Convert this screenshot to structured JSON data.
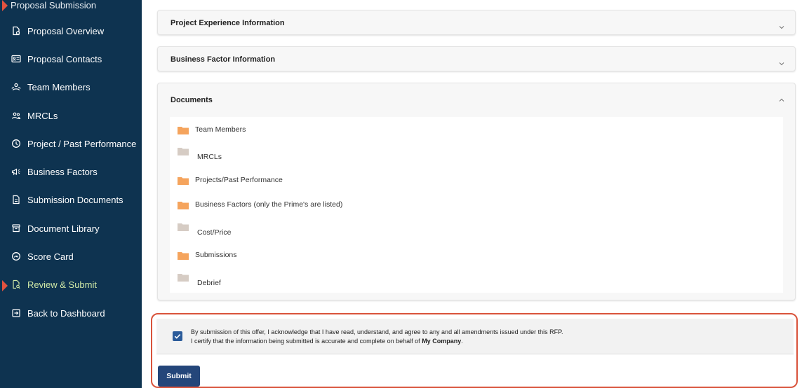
{
  "sidebar": {
    "header": "Proposal Submission",
    "items": [
      {
        "label": "Proposal Overview",
        "icon": "document-icon"
      },
      {
        "label": "Proposal Contacts",
        "icon": "contact-card-icon"
      },
      {
        "label": "Team Members",
        "icon": "team-icon"
      },
      {
        "label": "MRCLs",
        "icon": "users-icon"
      },
      {
        "label": "Project / Past Performance",
        "icon": "history-icon"
      },
      {
        "label": "Business Factors",
        "icon": "megaphone-icon"
      },
      {
        "label": "Submission Documents",
        "icon": "file-icon"
      },
      {
        "label": "Document Library",
        "icon": "archive-icon"
      },
      {
        "label": "Score Card",
        "icon": "gauge-icon"
      },
      {
        "label": "Review & Submit",
        "icon": "review-icon",
        "active": true
      },
      {
        "label": "Back to Dashboard",
        "icon": "exit-icon"
      }
    ]
  },
  "panels": {
    "project_experience": "Project Experience Information",
    "business_factor": "Business Factor Information",
    "documents": "Documents"
  },
  "documents": [
    {
      "label": "Team Members",
      "folder_color": "#f5a45d"
    },
    {
      "label": "MRCLs",
      "folder_color": "#d6ccc4"
    },
    {
      "label": "Projects/Past Performance",
      "folder_color": "#f5a45d"
    },
    {
      "label": "Business Factors (only the Prime's are listed)",
      "folder_color": "#f5a45d"
    },
    {
      "label": "Cost/Price",
      "folder_color": "#d6ccc4"
    },
    {
      "label": "Submissions",
      "folder_color": "#f5a45d"
    },
    {
      "label": "Debrief",
      "folder_color": "#d6ccc4"
    }
  ],
  "acknowledgement": {
    "line1": "By submission of this offer, I acknowledge that I have read, understand, and agree to any and all amendments issued under this RFP.",
    "line2_prefix": "I certify that the information being submitted is accurate and complete on behalf of ",
    "company": "My Company",
    "line2_suffix": ".",
    "checked": true
  },
  "submit_label": "Submit",
  "colors": {
    "sidebar_bg": "#0e3350",
    "active_marker": "#e2523f",
    "active_text": "#cfe8a6",
    "highlight_border": "#d9533b",
    "submit_bg": "#24467a",
    "checkbox": "#2b5b9a"
  }
}
